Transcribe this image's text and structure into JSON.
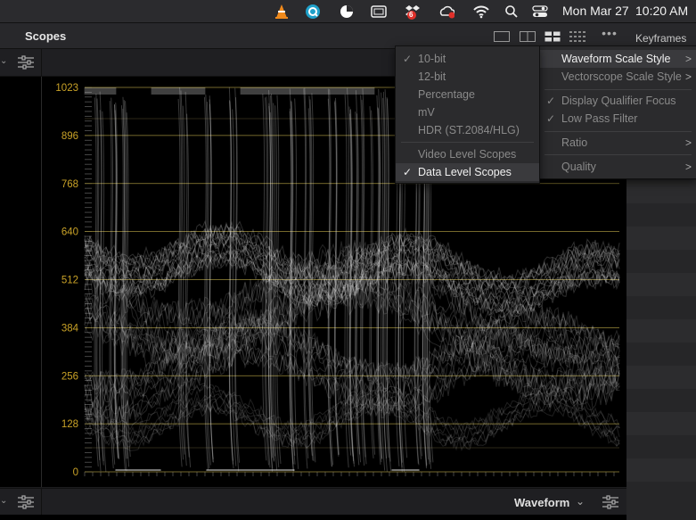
{
  "menubar": {
    "date": "Mon Mar 27",
    "time": "10:20 AM",
    "icons": [
      "vlc-icon",
      "quicktime-icon",
      "pie-app-icon",
      "screen-app-icon",
      "dropbox-icon",
      "creative-cloud-icon",
      "wifi-icon",
      "spotlight-icon",
      "control-center-icon"
    ],
    "dropbox_badge": "6"
  },
  "header": {
    "title": "Scopes",
    "keyframes": "Keyframes",
    "more": "•••"
  },
  "scope": {
    "y_labels": [
      "1023",
      "896",
      "768",
      "640",
      "512",
      "384",
      "256",
      "128",
      "0"
    ],
    "label_color": "#c9a227",
    "gridline_color": "#9a8a3a"
  },
  "bottom": {
    "scope_type": "Waveform",
    "chevron": "⌄"
  },
  "scale_menu": {
    "items": [
      {
        "label": "10-bit",
        "checked": true
      },
      {
        "label": "12-bit",
        "checked": false
      },
      {
        "label": "Percentage",
        "checked": false
      },
      {
        "label": "mV",
        "checked": false
      },
      {
        "label": "HDR (ST.2084/HLG)",
        "checked": false
      }
    ],
    "level_items": [
      {
        "label": "Video Level Scopes",
        "checked": false
      },
      {
        "label": "Data Level Scopes",
        "checked": true
      }
    ]
  },
  "options_menu": {
    "items": [
      {
        "label": "Waveform Scale Style",
        "submenu": true,
        "checked": false
      },
      {
        "label": "Vectorscope Scale Style",
        "submenu": true,
        "checked": false
      },
      {
        "label": "Display Qualifier Focus",
        "submenu": false,
        "checked": true
      },
      {
        "label": "Low Pass Filter",
        "submenu": false,
        "checked": true
      },
      {
        "label": "Ratio",
        "submenu": true,
        "checked": false
      },
      {
        "label": "Quality",
        "submenu": true,
        "checked": false
      }
    ]
  }
}
